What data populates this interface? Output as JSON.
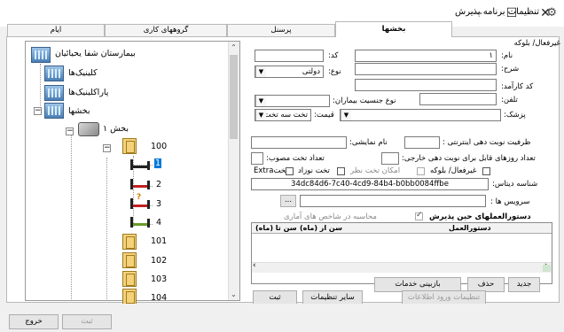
{
  "window": {
    "title": "تنظیمات برنامه پذیرش",
    "minimize": "—",
    "maximize": "☐",
    "close": "✕"
  },
  "tabs": [
    {
      "label": "بخشها"
    },
    {
      "label": "پرسنل"
    },
    {
      "label": "گروههای کاری"
    },
    {
      "label": "ایام"
    }
  ],
  "tree": {
    "root": "بیمارستان شفا یحیائیان",
    "clinics": "کلینیک‌ها",
    "paraclinics": "پاراکلینیک‌ها",
    "wards": "بخشها",
    "ward1": "بخش ۱",
    "room100": "100",
    "beds": [
      "1",
      "2",
      "3",
      "4"
    ],
    "rooms": [
      "101",
      "102",
      "103",
      "104"
    ],
    "expand_minus": "−"
  },
  "form": {
    "non_active_block": "غیرفعال/ بلوکه",
    "code_label": "کد:",
    "name_label": "نام:",
    "name_value": "۱",
    "desc_label": "شرح:",
    "type_label": "نوع:",
    "type_value": "دولتی",
    "kardex_label": "کد کارآمد:",
    "gender_label": "نوع جنسیت بیماران:",
    "phone_label": "تلفن:",
    "physician_label": "پزشک:",
    "price_label": "قیمت:",
    "price_value": "تخت سه تخت و بیشتر",
    "internet_capacity_label": "ظرفیت نوبت دهی اینترنتی :",
    "display_name_label": "نام نمایشی:",
    "external_days_label": "تعداد روزهای قابل برای نوبت دهی خارجی:",
    "approved_beds_label": "تعداد تخت مصوب:",
    "chk_block": "غیرفعال/ بلوکه",
    "chk_observation": "امکان تخت نظر",
    "chk_newborn": "تخت نوزاد",
    "chk_extra": "تختExtra",
    "dataset_id_label": "شناسه دیتاس:",
    "dataset_id_value": "34dc84d6-7c40-4cd9-84b4-b0bb0084ffbe",
    "services_label": "سرویس ها :",
    "browse_button": "...",
    "orders_title": "دستورالعملهای حین پذیرش",
    "orders_statistics": "محاسبه در شاخص های آماری",
    "grid_cols": [
      "دستورالعمل",
      "سن از (ماه)",
      "سن تا (ماه)"
    ],
    "btn_new": "جدید",
    "btn_delete": "حذف",
    "btn_restore": "بازبینی خدمات",
    "btn_save": "ثبت",
    "btn_other": "سایر تنظیمات",
    "btn_login_info": "تنظیمات ورود اطلاعات"
  },
  "footer": {
    "exit": "خروج",
    "save": "ثبت"
  }
}
